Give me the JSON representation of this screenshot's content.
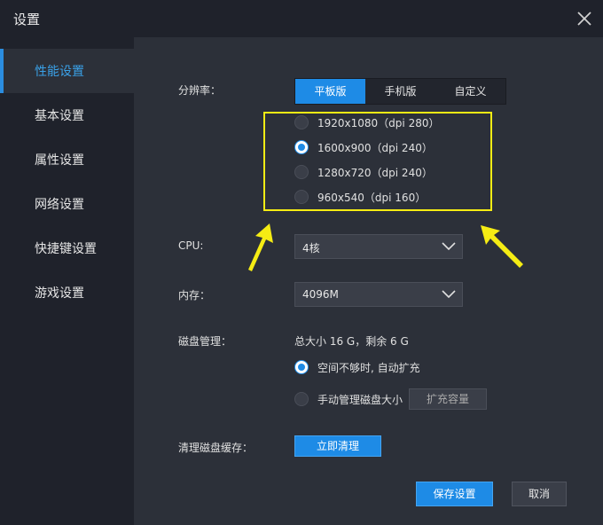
{
  "window": {
    "title": "设置"
  },
  "sidebar": {
    "items": [
      {
        "label": "性能设置",
        "active": true
      },
      {
        "label": "基本设置"
      },
      {
        "label": "属性设置"
      },
      {
        "label": "网络设置"
      },
      {
        "label": "快捷键设置"
      },
      {
        "label": "游戏设置"
      }
    ]
  },
  "resolution": {
    "label": "分辨率：",
    "modes": [
      "平板版",
      "手机版",
      "自定义"
    ],
    "selected_mode": "平板版",
    "options": [
      "1920x1080（dpi 280）",
      "1600x900（dpi 240）",
      "1280x720（dpi 240）",
      "960x540（dpi 160）"
    ],
    "selected_option": "1600x900（dpi 240）"
  },
  "cpu": {
    "label": "CPU:",
    "value": "4核"
  },
  "memory": {
    "label": "内存：",
    "value": "4096M"
  },
  "disk": {
    "label": "磁盘管理：",
    "info": "总大小 16 G，剩余 6 G",
    "auto_option": "空间不够时, 自动扩充",
    "manual_option": "手动管理磁盘大小",
    "expand_button": "扩充容量"
  },
  "cache": {
    "label": "清理磁盘缓存：",
    "button": "立即清理"
  },
  "footer": {
    "save": "保存设置",
    "cancel": "取消"
  },
  "colors": {
    "accent": "#1e8be6",
    "highlight": "#f5ec14",
    "panel": "#2c3039",
    "sidebar": "#1f222b"
  }
}
